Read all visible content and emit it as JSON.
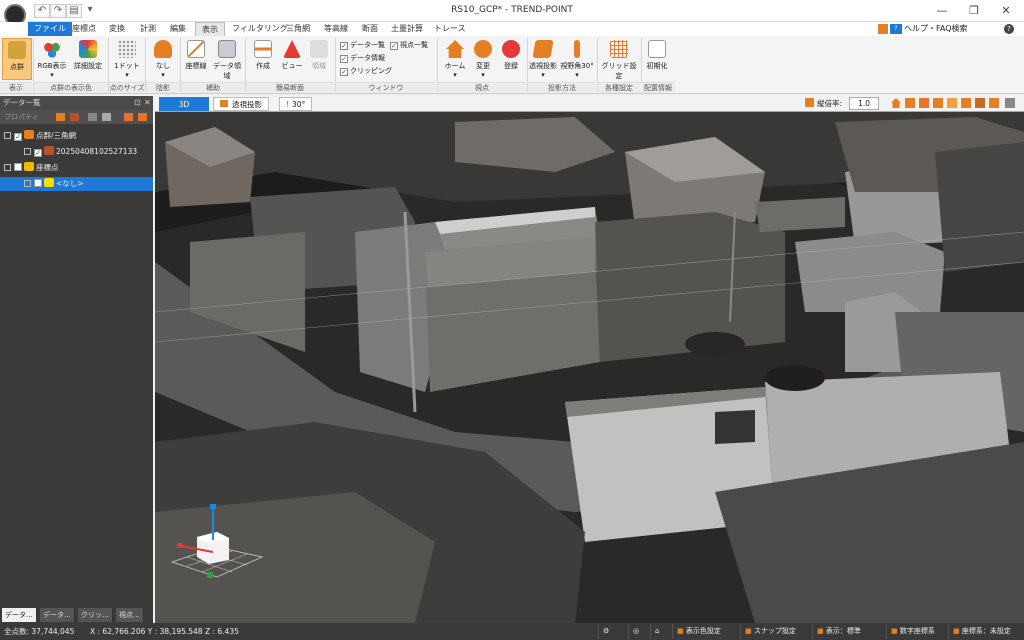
{
  "app": {
    "title": "RS10_GCP* - TREND-POINT"
  },
  "menu": {
    "items": [
      "ファイル",
      "座標点",
      "変換",
      "計測",
      "編集",
      "表示",
      "フィルタリング",
      "三角網",
      "等高線",
      "断面",
      "土量計算",
      "トレース"
    ],
    "active": "表示"
  },
  "help": {
    "label": "ヘルプ・FAQ検索"
  },
  "ribbon": {
    "display": {
      "btn": "点群",
      "group": "表示"
    },
    "color": {
      "rgb": "RGB表示",
      "detail": "詳細設定",
      "group": "点群の表示色"
    },
    "size": {
      "btn": "1ドット",
      "group": "点のサイズ"
    },
    "shade": {
      "btn": "なし",
      "group": "陰影"
    },
    "aux": {
      "axis": "座標線",
      "data_area": "データ領域",
      "group": "補助"
    },
    "section": {
      "create": "作成",
      "view": "ビュー",
      "area": "領域",
      "group": "簡易断面"
    },
    "window": {
      "data_list": "データ一覧",
      "view_list": "視点一覧",
      "data_info": "データ情報",
      "clipping": "クリッピング",
      "group": "ウィンドウ"
    },
    "viewpoint": {
      "home": "ホーム",
      "change": "変更",
      "register": "登録",
      "group": "視点"
    },
    "projection": {
      "perspective": "透視投影",
      "fov": "視野角30°",
      "group": "投影方法"
    },
    "settings": {
      "grid": "グリッド設定",
      "group": "各種設定"
    },
    "layout": {
      "reset": "初期化",
      "group": "配置情報"
    }
  },
  "panel": {
    "title": "データ一覧",
    "tools": "プロパティ",
    "tree": [
      {
        "label": "点群/三角網",
        "checked": true
      },
      {
        "label": "20250408102527133",
        "checked": true
      },
      {
        "label": "座標点",
        "checked": false
      },
      {
        "label": "<なし>",
        "checked": false
      }
    ],
    "tabs": [
      "データ...",
      "データ...",
      "クリッ...",
      "視点..."
    ]
  },
  "viewbar": {
    "tab3d": "3D",
    "perspective": "透視投影",
    "fov": "30°",
    "scale_label": "縦倍率:",
    "scale_value": "1.0"
  },
  "status": {
    "points": "全点数: 37,744,045",
    "coords": "X : 62,766.206  Y : 38,195.548  Z : 6.435",
    "color_setting": "表示色設定",
    "snap_setting": "スナップ設定",
    "display": "表示：標準",
    "coord_system": "数字座標系",
    "crs": "座標系：未設定"
  },
  "colors": {
    "accent": "#1e7ad6",
    "active_btn": "#f9c87a"
  }
}
